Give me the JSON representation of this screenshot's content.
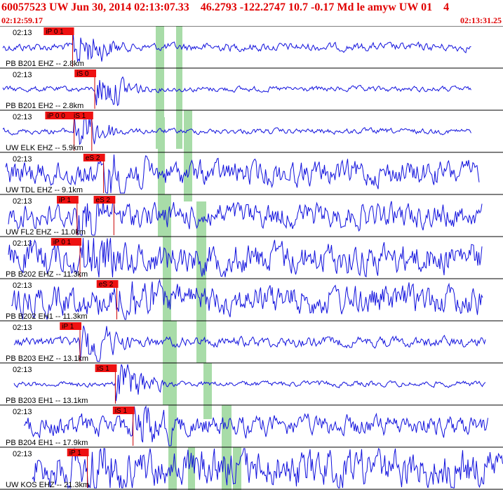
{
  "header": {
    "title": "60057523 UW Jun 30, 2014 02:13:07.33    46.2793 -122.2747 10.7 -0.17 Md le amyw UW 01    4",
    "start_time": "02:12:59.17",
    "end_time": "02:13:31.25"
  },
  "colors": {
    "trace": "#1010dd",
    "pick_box": "#ee1111",
    "pick_text": "#000000",
    "pick_line": "#cc0000",
    "shade": "#a8dca8",
    "header_text": "#e00000",
    "separator": "#000000"
  },
  "chart_data": {
    "type": "line",
    "title": "60057523 UW Jun 30, 2014 02:13:07.33    46.2793 -122.2747 10.7 -0.17 Md le amyw UW 01    4",
    "x_range": [
      "02:12:59.17",
      "02:13:31.25"
    ],
    "panel_time_label": "02:13",
    "grid": false,
    "traces": [
      {
        "label": "PB B201 EHZ -- 2.8km",
        "amplitude": 0.18,
        "picks": [
          {
            "label": "iP 0 1",
            "time": "02:13:04.1"
          }
        ]
      },
      {
        "label": "PB B201 EH2 -- 2.8km",
        "amplitude": 0.12,
        "picks": [
          {
            "label": "iS 0",
            "time": "02:13:05.6"
          }
        ]
      },
      {
        "label": "UW ELK EHZ -- 5.9km",
        "amplitude": 0.12,
        "picks": [
          {
            "label": "iP 0 0",
            "time": "02:13:04.2"
          },
          {
            "label": "iS 1",
            "time": "02:13:05.4"
          }
        ]
      },
      {
        "label": "UW TDL EHZ -- 9.1km",
        "amplitude": 0.55,
        "picks": [
          {
            "label": "eS 2",
            "time": "02:13:06.2"
          }
        ]
      },
      {
        "label": "UW FL2 EHZ -- 11.0km",
        "amplitude": 0.55,
        "picks": [
          {
            "label": "iP 1",
            "time": "02:13:04.4"
          },
          {
            "label": "eS 2",
            "time": "02:13:06.9"
          }
        ]
      },
      {
        "label": "PB B202 EHZ -- 11.3km",
        "amplitude": 0.7,
        "picks": [
          {
            "label": "iP 0 1",
            "time": "02:13:04.6"
          }
        ]
      },
      {
        "label": "PB B202 EH1 -- 11.3km",
        "amplitude": 0.65,
        "picks": [
          {
            "label": "eS 2",
            "time": "02:13:07.1"
          }
        ]
      },
      {
        "label": "PB B203 EHZ -- 13.1km",
        "amplitude": 0.22,
        "picks": [
          {
            "label": "iP 1",
            "time": "02:13:04.6"
          }
        ]
      },
      {
        "label": "PB B203 EH1 -- 13.1km",
        "amplitude": 0.12,
        "picks": [
          {
            "label": "iS 1",
            "time": "02:13:07.0"
          }
        ]
      },
      {
        "label": "PB B204 EH1 -- 17.9km",
        "amplitude": 0.45,
        "picks": [
          {
            "label": "iS 1",
            "time": "02:13:08.2"
          }
        ]
      },
      {
        "label": "UW KOS EHZ -- 21.3km",
        "amplitude": 0.85,
        "picks": [
          {
            "label": "iP 1",
            "time": "02:13:05.1"
          }
        ]
      }
    ]
  }
}
